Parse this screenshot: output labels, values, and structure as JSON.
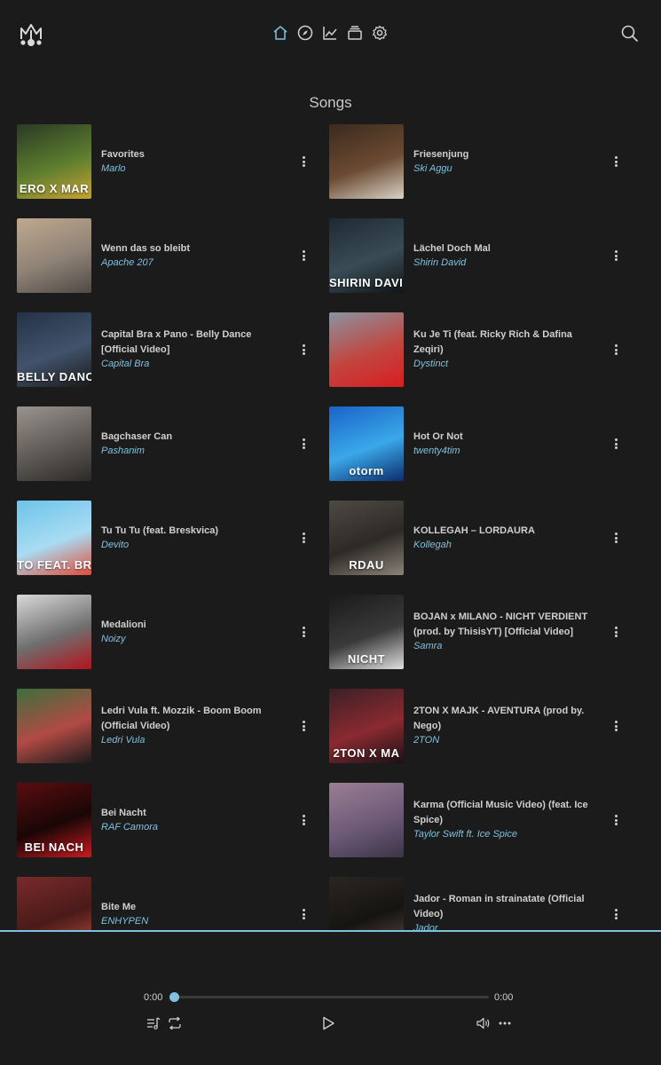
{
  "header": {
    "logo_icon": "crown-notes-logo",
    "nav": [
      {
        "name": "home-icon",
        "active": true
      },
      {
        "name": "compass-icon",
        "active": false
      },
      {
        "name": "trending-chart-icon",
        "active": false
      },
      {
        "name": "library-stack-icon",
        "active": false
      },
      {
        "name": "gear-icon",
        "active": false
      }
    ],
    "search_icon": "search-icon"
  },
  "section_title": "Songs",
  "songs": [
    {
      "title": "Favorites",
      "artist": "Marlo",
      "thumb_text": "ERO X MAR",
      "thumb_colors": [
        "#2a3a24",
        "#5d7d2f",
        "#c7a233"
      ]
    },
    {
      "title": "Friesenjung",
      "artist": "Ski Aggu",
      "thumb_text": "",
      "thumb_colors": [
        "#3b2a1d",
        "#6b4b32",
        "#d9d2c7"
      ]
    },
    {
      "title": "Wenn das so bleibt",
      "artist": "Apache 207",
      "thumb_text": "",
      "thumb_colors": [
        "#bfa98e",
        "#8f8276",
        "#4f4a45"
      ]
    },
    {
      "title": "Lächel Doch Mal",
      "artist": "Shirin David",
      "thumb_text": "SHIRIN DAVID",
      "thumb_colors": [
        "#1e2a33",
        "#3a4b55",
        "#101518"
      ]
    },
    {
      "title": "Capital Bra x Pano - Belly Dance [Official Video]",
      "artist": "Capital Bra",
      "thumb_text": "BELLY DANCE",
      "thumb_colors": [
        "#243247",
        "#41536b",
        "#1a1a1a"
      ]
    },
    {
      "title": "Ku Je Ti (feat. Ricky Rich & Dafina Zeqiri)",
      "artist": "Dystinct",
      "thumb_text": "",
      "thumb_colors": [
        "#8a93a1",
        "#c1463f",
        "#d91d21"
      ]
    },
    {
      "title": "Bagchaser Can",
      "artist": "Pashanim",
      "thumb_text": "",
      "thumb_colors": [
        "#9a9490",
        "#5e5955",
        "#2c2a28"
      ]
    },
    {
      "title": "Hot Or Not",
      "artist": "twenty4tim",
      "thumb_text": "otorm",
      "thumb_colors": [
        "#1a63c8",
        "#3aa8e8",
        "#0c2c6b"
      ]
    },
    {
      "title": "Tu Tu Tu (feat. Breskvica)",
      "artist": "Devito",
      "thumb_text": "TO FEAT. BRESK",
      "thumb_colors": [
        "#6ec3ea",
        "#a8dcf2",
        "#e24d3a"
      ]
    },
    {
      "title": "KOLLEGAH – LORDAURA",
      "artist": "Kollegah",
      "thumb_text": "RDAU",
      "thumb_colors": [
        "#4e4943",
        "#2d2a26",
        "#8d8378"
      ]
    },
    {
      "title": "Medalioni",
      "artist": "Noizy",
      "thumb_text": "",
      "thumb_colors": [
        "#d9d9d9",
        "#6f6f6f",
        "#b2141c"
      ]
    },
    {
      "title": "BOJAN x MILANO - NICHT VERDIENT (prod. by ThisisYT) [Official Video]",
      "artist": "Samra",
      "thumb_text": "NICHT",
      "thumb_colors": [
        "#1a1a1a",
        "#3a3a3a",
        "#e0e0e0"
      ]
    },
    {
      "title": "Ledri Vula ft. Mozzik - Boom Boom (Official Video)",
      "artist": "Ledri Vula",
      "thumb_text": "",
      "thumb_colors": [
        "#3d6f3a",
        "#b24a44",
        "#1b1b1b"
      ]
    },
    {
      "title": "2TON X MAJK - AVENTURA (prod by. Nego)",
      "artist": "2TON",
      "thumb_text": "2TON X MA",
      "thumb_colors": [
        "#3b2026",
        "#8a2a30",
        "#1a1216"
      ]
    },
    {
      "title": "Bei Nacht",
      "artist": "RAF Camora",
      "thumb_text": "BEI NACH",
      "thumb_colors": [
        "#5a0d10",
        "#1a0606",
        "#c81a20"
      ]
    },
    {
      "title": "Karma (Official Music Video) (feat. Ice Spice)",
      "artist": "Taylor Swift ft. Ice Spice",
      "thumb_text": "",
      "thumb_colors": [
        "#9a7f93",
        "#6d5a78",
        "#3c3447"
      ]
    },
    {
      "title": "Bite Me",
      "artist": "ENHYPEN",
      "thumb_text": "",
      "thumb_colors": [
        "#7a2a2a",
        "#4a1a1a",
        "#b54a3a"
      ]
    },
    {
      "title": "Jador - Roman in strainatate (Official Video)",
      "artist": "Jador",
      "thumb_text": "",
      "thumb_colors": [
        "#2a2622",
        "#161412",
        "#5a4c40"
      ]
    }
  ],
  "player": {
    "time_current": "0:00",
    "time_total": "0:00",
    "progress": 0,
    "accent_color": "#7ec2e0",
    "controls": [
      "queue-list-icon",
      "repeat-icon",
      "play-icon",
      "volume-icon",
      "more-horizontal-icon"
    ]
  }
}
